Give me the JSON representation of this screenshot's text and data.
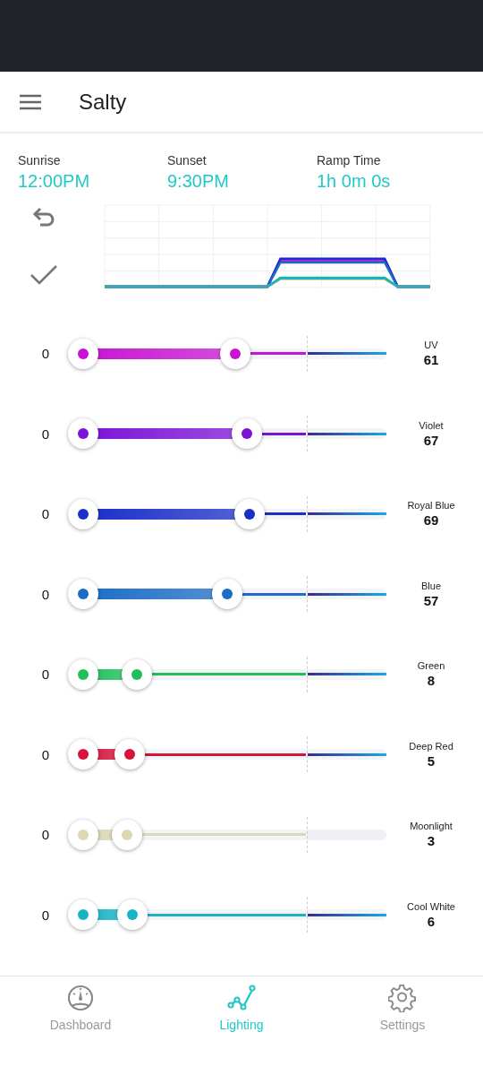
{
  "app_bar": {
    "title": "Salty"
  },
  "schedule": [
    {
      "label": "Sunrise",
      "value": "12:00PM"
    },
    {
      "label": "Sunset",
      "value": "9:30PM"
    },
    {
      "label": "Ramp Time",
      "value": "1h 0m 0s"
    }
  ],
  "channels": [
    {
      "name": "UV",
      "low": "0",
      "value": "61",
      "color": "#c814d2",
      "level": 0.5,
      "boost": true
    },
    {
      "name": "Violet",
      "low": "0",
      "value": "67",
      "color": "#7d12d6",
      "level": 0.54,
      "boost": true
    },
    {
      "name": "Royal Blue",
      "low": "0",
      "value": "69",
      "color": "#1a2ec8",
      "level": 0.55,
      "boost": true
    },
    {
      "name": "Blue",
      "low": "0",
      "value": "57",
      "color": "#1a6cc8",
      "level": 0.475,
      "boost": true
    },
    {
      "name": "Green",
      "low": "0",
      "value": "8",
      "color": "#1fbf5a",
      "level": 0.177,
      "boost": true
    },
    {
      "name": "Deep Red",
      "low": "0",
      "value": "5",
      "color": "#d8123a",
      "level": 0.153,
      "boost": true
    },
    {
      "name": "Moonlight",
      "low": "0",
      "value": "3",
      "color": "#dcd8b4",
      "level": 0.145,
      "boost": false
    },
    {
      "name": "Cool White",
      "low": "0",
      "value": "6",
      "color": "#18b4c4",
      "level": 0.162,
      "boost": true
    }
  ],
  "bottom_nav": [
    {
      "label": "Dashboard",
      "selected": false
    },
    {
      "label": "Lighting",
      "selected": true
    },
    {
      "label": "Settings",
      "selected": false
    }
  ]
}
